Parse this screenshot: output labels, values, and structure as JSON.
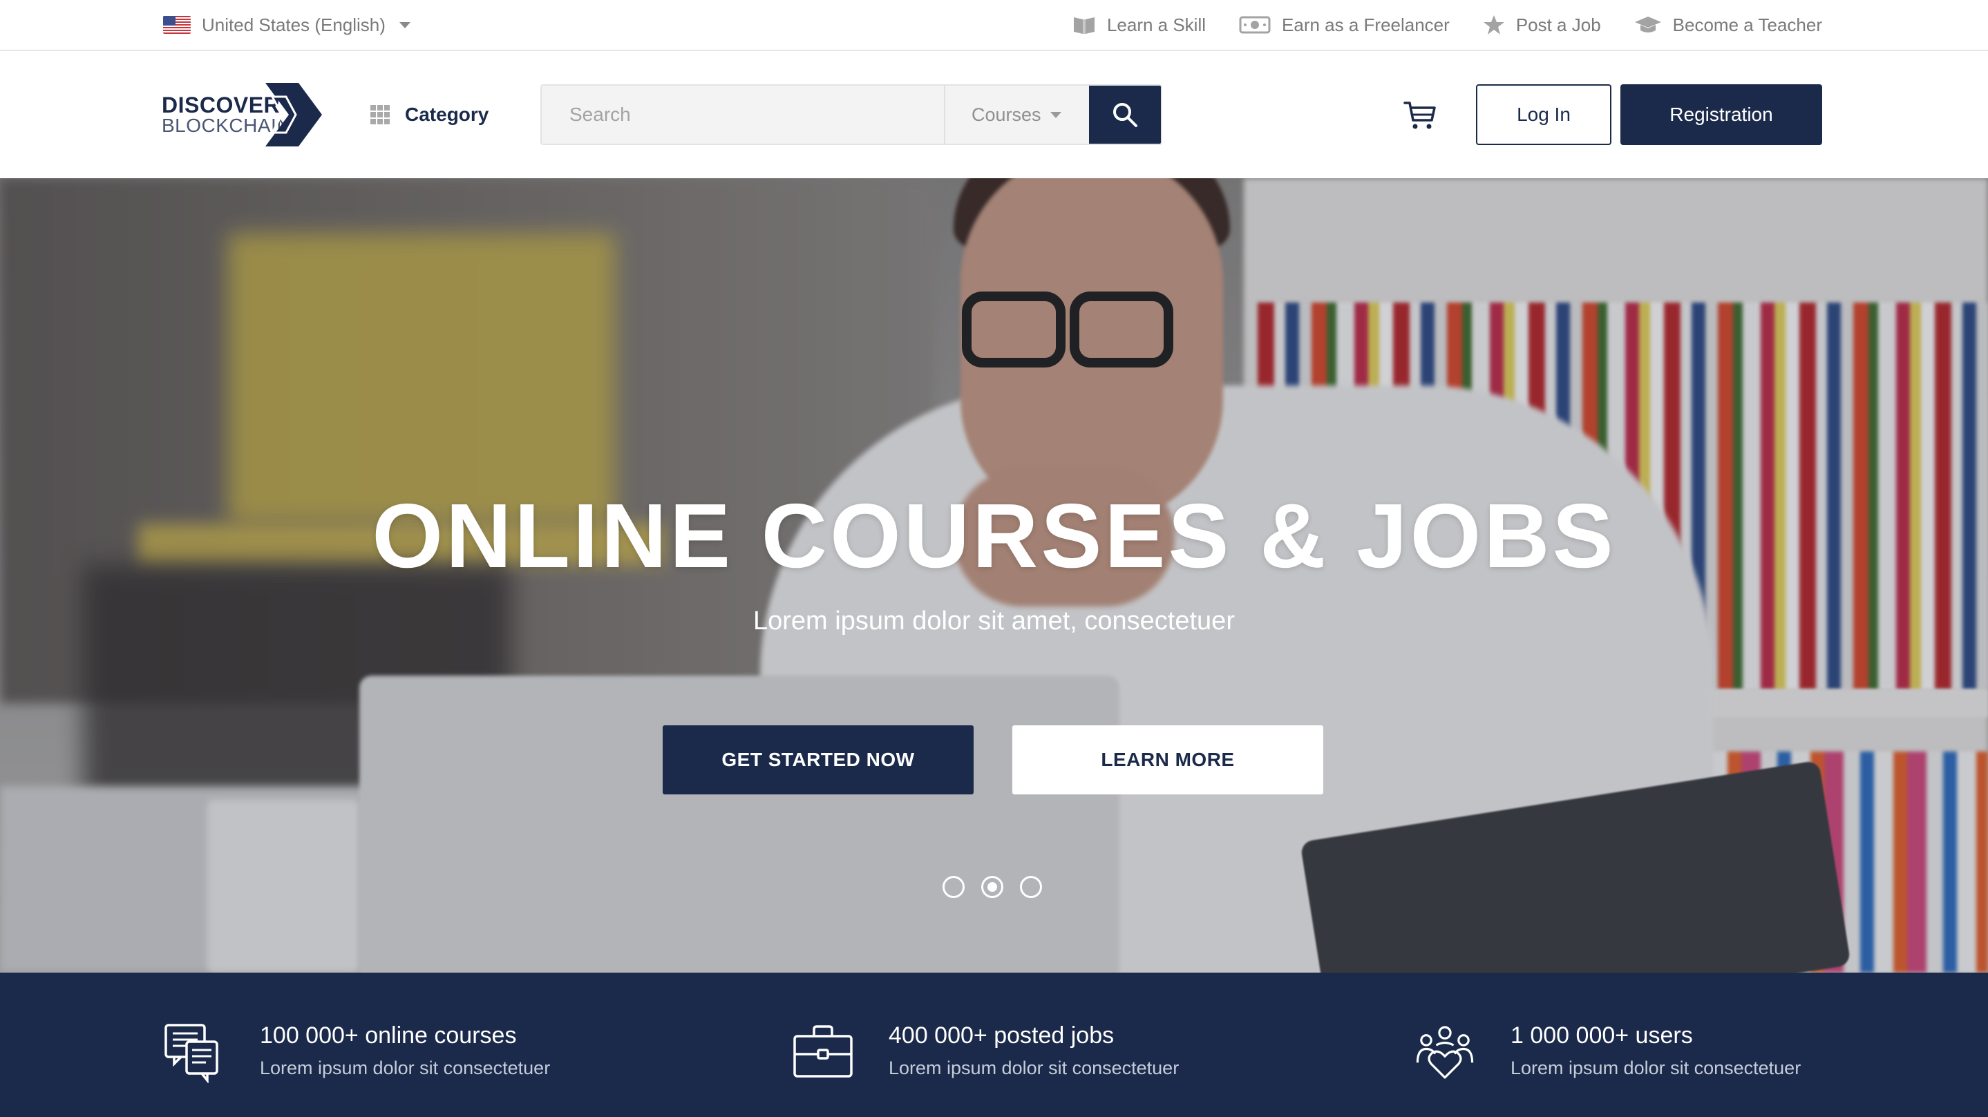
{
  "topbar": {
    "language": "United States (English)",
    "links": [
      {
        "label": "Learn a Skill",
        "icon": "book-icon"
      },
      {
        "label": "Earn as a Freelancer",
        "icon": "money-icon"
      },
      {
        "label": "Post a Job",
        "icon": "star-icon"
      },
      {
        "label": "Become a Teacher",
        "icon": "graduation-cap-icon"
      }
    ]
  },
  "header": {
    "logo": {
      "line1": "DISCOVER",
      "line2": "BLOCKCHAIN"
    },
    "category_label": "Category",
    "search": {
      "placeholder": "Search",
      "value": "",
      "scope": "Courses"
    },
    "login_label": "Log In",
    "register_label": "Registration"
  },
  "hero": {
    "title": "ONLINE COURSES & JOBS",
    "subtitle": "Lorem ipsum dolor sit amet, consectetuer",
    "primary_button": "GET STARTED NOW",
    "secondary_button": "LEARN MORE",
    "slides_total": 3,
    "active_slide": 2
  },
  "stats": [
    {
      "title": "100 000+ online courses",
      "desc": "Lorem ipsum dolor sit consectetuer",
      "icon": "courses-icon"
    },
    {
      "title": "400 000+  posted jobs",
      "desc": "Lorem ipsum dolor sit consectetuer",
      "icon": "briefcase-icon"
    },
    {
      "title": "1 000 000+ users",
      "desc": "Lorem ipsum dolor sit consectetuer",
      "icon": "users-icon"
    }
  ],
  "colors": {
    "brand": "#1b2a4a",
    "muted_text": "#7a7a7a",
    "white": "#ffffff"
  }
}
